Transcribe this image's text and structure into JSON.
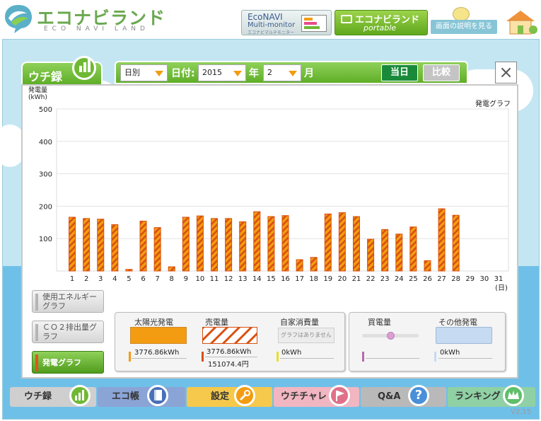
{
  "header": {
    "logo_main": "エコナビランド",
    "logo_sub": "ECO NAVI LAND",
    "econavi": {
      "line1": "EcoNAVI",
      "line2": "Multi-monitor",
      "line3": "エコナビマルチモニター"
    },
    "portable": {
      "line1": "エコナビランド",
      "line2": "portable"
    },
    "explain_label": "画面の説明を見る"
  },
  "uchiroku": {
    "tab_label": "ウチ録"
  },
  "toolbar": {
    "period_select": "日別",
    "date_label": "日付:",
    "year_select": "2015",
    "year_unit": "年",
    "month_select": "2",
    "month_unit": "月",
    "today_button": "当日",
    "compare_button": "比較",
    "close_button": "×"
  },
  "side_buttons": {
    "energy": "使用エネルギーグラフ",
    "co2": "ＣＯ２排出量グラフ",
    "power": "発電グラフ"
  },
  "legend": {
    "solar": {
      "title": "太陽光発電",
      "value": "3776.86kWh"
    },
    "sold": {
      "title": "売電量",
      "value": "3776.86kWh",
      "yen": "151074.4円"
    },
    "self": {
      "title": "自家消費量",
      "note": "グラフはありません",
      "value": "0kWh"
    },
    "bought": {
      "title": "買電量"
    },
    "other": {
      "title": "その他発電",
      "value": "0kWh"
    }
  },
  "nav": {
    "uchiroku": "ウチ録",
    "ecocho": "エコ帳",
    "settings": "設定",
    "uchichare": "ウチチャレ",
    "qa": "Q&A",
    "ranking": "ランキング"
  },
  "version": "V2.15",
  "colors": {
    "bar_fill": "#f39c12",
    "bar_stroke": "#d94f0e",
    "accent_green": "#6fb833"
  },
  "chart_data": {
    "type": "bar",
    "title": "発電グラフ",
    "ylabel": "発電量\n(kWh)",
    "xlabel": "(日)",
    "ylim": [
      0,
      500
    ],
    "yticks": [
      100,
      200,
      300,
      400,
      500
    ],
    "categories": [
      "1",
      "2",
      "3",
      "4",
      "5",
      "6",
      "7",
      "8",
      "9",
      "10",
      "11",
      "12",
      "13",
      "14",
      "15",
      "16",
      "17",
      "18",
      "19",
      "20",
      "21",
      "22",
      "23",
      "24",
      "25",
      "26",
      "27",
      "28",
      "29",
      "30",
      "31"
    ],
    "values": [
      166,
      162,
      160,
      143,
      5,
      154,
      134,
      13,
      166,
      170,
      162,
      162,
      152,
      183,
      168,
      171,
      35,
      42,
      176,
      180,
      168,
      98,
      128,
      114,
      136,
      32,
      192,
      172,
      null,
      null,
      null
    ],
    "grid": true
  }
}
